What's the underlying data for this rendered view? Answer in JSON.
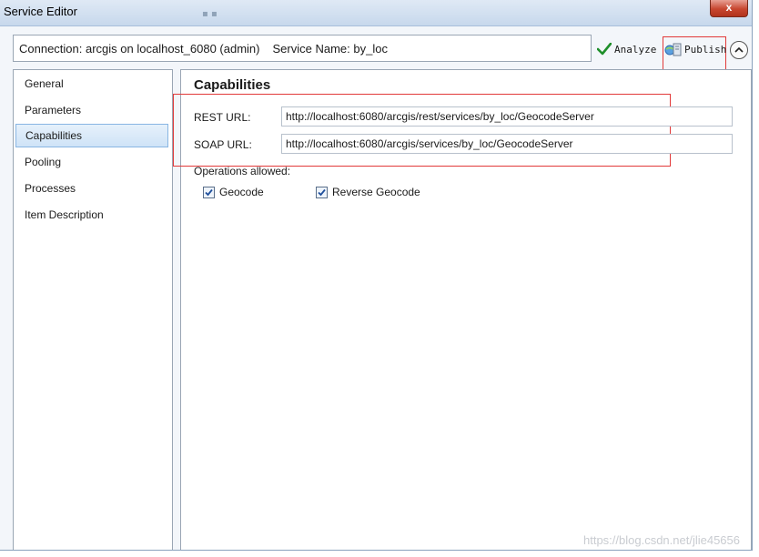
{
  "window": {
    "title": "Service Editor",
    "close_label": "x"
  },
  "connection": {
    "connection_text": "Connection: arcgis on localhost_6080 (admin)",
    "service_text": "Service Name: by_loc"
  },
  "toolbar": {
    "analyze_label": "Analyze",
    "publish_label": "Publish"
  },
  "sidebar": {
    "items": [
      {
        "label": "General"
      },
      {
        "label": "Parameters"
      },
      {
        "label": "Capabilities",
        "selected": true
      },
      {
        "label": "Pooling"
      },
      {
        "label": "Processes"
      },
      {
        "label": "Item Description"
      }
    ]
  },
  "capabilities": {
    "title": "Capabilities",
    "rest_label": "REST URL:",
    "rest_value": "http://localhost:6080/arcgis/rest/services/by_loc/GeocodeServer",
    "soap_label": "SOAP URL:",
    "soap_value": "http://localhost:6080/arcgis/services/by_loc/GeocodeServer",
    "operations_label": "Operations allowed:",
    "operations": [
      {
        "label": "Geocode",
        "checked": true
      },
      {
        "label": "Reverse Geocode",
        "checked": true
      }
    ]
  },
  "watermark": "https://blog.csdn.net/jlie45656",
  "colors": {
    "highlight": "#e23a3a",
    "selection": "#cfe3f7",
    "check": "#1f4f9c"
  }
}
